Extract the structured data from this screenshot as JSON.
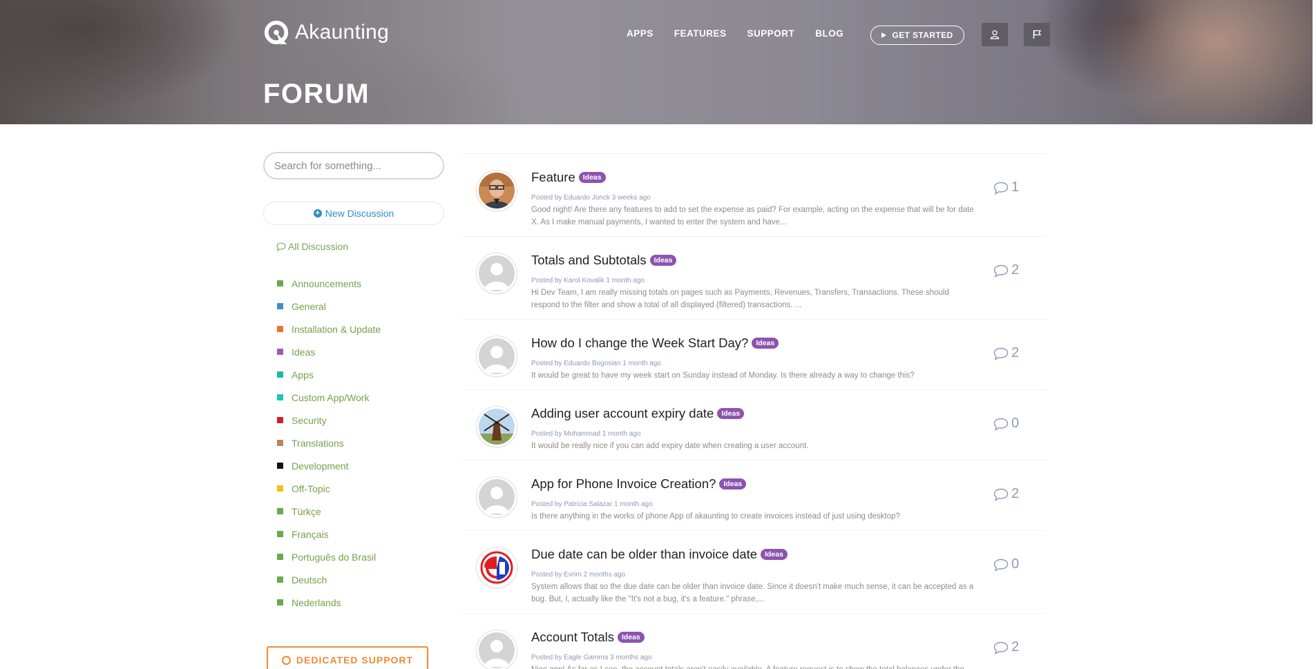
{
  "brand": {
    "name": "Akaunting"
  },
  "nav": {
    "items": [
      "APPS",
      "FEATURES",
      "SUPPORT",
      "BLOG"
    ],
    "get_started": "GET STARTED"
  },
  "page": {
    "heading": "FORUM"
  },
  "sidebar": {
    "search_placeholder": "Search for something...",
    "new_discussion": "New Discussion",
    "all_discussion": "All Discussion",
    "categories": [
      {
        "label": "Announcements",
        "color": "#6aa84f"
      },
      {
        "label": "General",
        "color": "#3d8fd1"
      },
      {
        "label": "Installation & Update",
        "color": "#e8772e"
      },
      {
        "label": "Ideas",
        "color": "#9b59b6"
      },
      {
        "label": "Apps",
        "color": "#1abc9c"
      },
      {
        "label": "Custom App/Work",
        "color": "#17c9b3"
      },
      {
        "label": "Security",
        "color": "#d0202a"
      },
      {
        "label": "Translations",
        "color": "#b9865a"
      },
      {
        "label": "Development",
        "color": "#111111"
      },
      {
        "label": "Off-Topic",
        "color": "#f1c40f"
      },
      {
        "label": "Türkçe",
        "color": "#6aa84f"
      },
      {
        "label": "Français",
        "color": "#6aa84f"
      },
      {
        "label": "Português do Brasil",
        "color": "#6aa84f"
      },
      {
        "label": "Deutsch",
        "color": "#6aa84f"
      },
      {
        "label": "Nederlands",
        "color": "#6aa84f"
      }
    ],
    "dedicated_support": "DEDICATED SUPPORT"
  },
  "discussions": [
    {
      "title": "Feature",
      "tag": "Ideas",
      "meta": "Posted by Eduardo Jonck 3 weeks ago",
      "excerpt": "Good night! Are there any features to add to set the expense as paid? For example, acting on the expense that will be for date X. As I make manual payments, I wanted to enter the system and have...",
      "comments": "1",
      "avatar": "photo-man"
    },
    {
      "title": "Totals and Subtotals",
      "tag": "Ideas",
      "meta": "Posted by Karol Kovalik 1 month ago",
      "excerpt": "Hi Dev Team, I am really missing totals on pages such as Payments, Revenues, Transfers, Transactions. These should respond to the filter and show a total of all displayed (filtered) transactions. ...",
      "comments": "2",
      "avatar": "default"
    },
    {
      "title": "How do I change the Week Start Day?",
      "tag": "Ideas",
      "meta": "Posted by Eduardo Bogosian 1 month ago",
      "excerpt": "It would be great to have my week start on Sunday instead of Monday. Is there already a way to change this?",
      "comments": "2",
      "avatar": "default"
    },
    {
      "title": "Adding user account expiry date",
      "tag": "Ideas",
      "meta": "Posted by Mohammad 1 month ago",
      "excerpt": "It would be really nice if you can add expiry date when creating a user account.",
      "comments": "0",
      "avatar": "windmill"
    },
    {
      "title": "App for Phone Invoice Creation?",
      "tag": "Ideas",
      "meta": "Posted by Patricia Salazar 1 month ago",
      "excerpt": "Is there anything in the works of phone App of akaunting to create invoices instead of just using desktop?",
      "comments": "2",
      "avatar": "default"
    },
    {
      "title": "Due date can be older than invoice date",
      "tag": "Ideas",
      "meta": "Posted by Evrim 2 months ago",
      "excerpt": "System allows that so the due date can be older than invoice date. Since it doesn't make much sense, it can be accepted as a bug. But, I, actually like the \"It's not a bug, it's a feature.\" phrase,...",
      "comments": "0",
      "avatar": "logo-ed"
    },
    {
      "title": "Account Totals",
      "tag": "Ideas",
      "meta": "Posted by Eagle Gamma 3 months ago",
      "excerpt": "Nice app! As far as I see, the account totals aren't easily available. A feature request is to show the total balances under the",
      "comments": "2",
      "avatar": "default"
    }
  ]
}
